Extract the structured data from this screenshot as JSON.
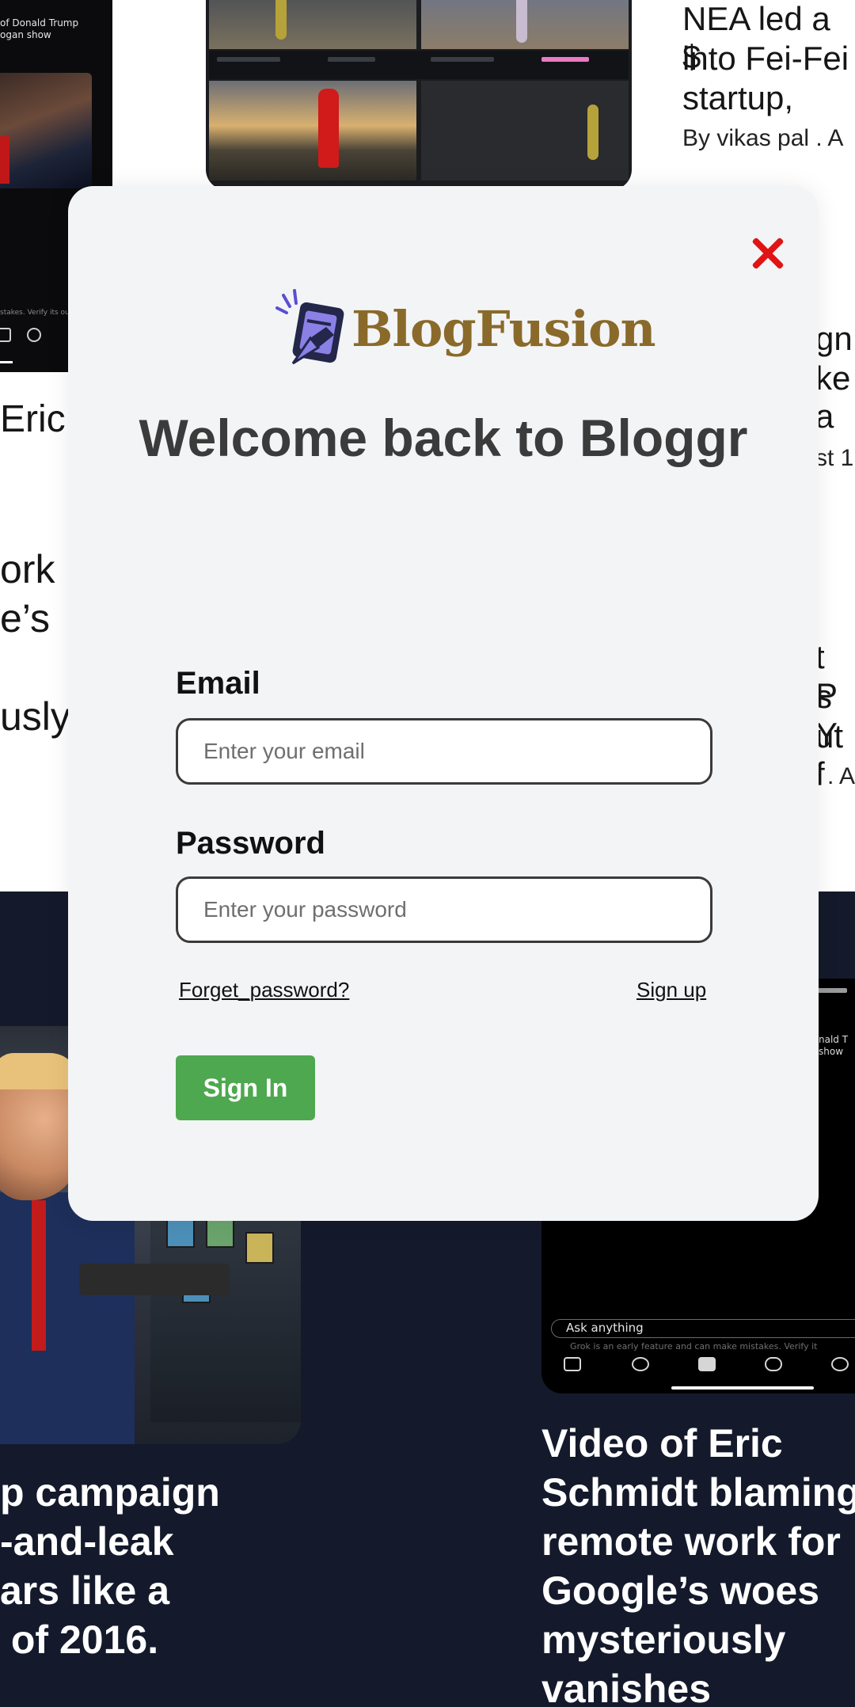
{
  "background": {
    "top_left_card": {
      "caption": "of Donald Trump\nogan show",
      "footer_note": "stakes. Verify its ou",
      "headline_fragment": "Eric"
    },
    "left_fragments": [
      "ork",
      "e’s",
      "usly"
    ],
    "top_right_card": {
      "headline_lines": [
        "NEA led a $",
        "into Fei-Fei",
        "startup,"
      ],
      "byline": "By vikas pal . A"
    },
    "right_fragments_1": [
      "gn",
      "ke a",
      "st 1"
    ],
    "right_fragments_2": [
      "t P",
      "s Y",
      "ut f",
      "l . A"
    ],
    "bottom_left_card": {
      "headline_lines": [
        "p campaign",
        "-and-leak",
        "ars like a",
        " of 2016."
      ]
    },
    "bottom_right_card": {
      "prompt": "Ask anything",
      "note": "Grok is an early feature and can make mistakes. Verify it",
      "side_caption": "nald T\nshow",
      "headline_lines": [
        "Video of Eric",
        "Schmidt blaming",
        "remote work for",
        "Google’s woes",
        "mysteriously",
        "vanishes"
      ]
    }
  },
  "modal": {
    "close_icon": "close-icon",
    "brand": {
      "name": "BlogFusion",
      "icon": "blog-edit-icon",
      "color": "#8a6a2a"
    },
    "welcome_title": "Welcome back to Bloggr",
    "email": {
      "label": "Email",
      "placeholder": "Enter your email",
      "value": ""
    },
    "password": {
      "label": "Password",
      "placeholder": "Enter your password",
      "value": ""
    },
    "forgot_link": "Forget_password?",
    "signup_link": "Sign up",
    "signin_button": "Sign In",
    "colors": {
      "close": "#e01414",
      "signin": "#4ea84f",
      "background": "#f3f4f6"
    }
  }
}
